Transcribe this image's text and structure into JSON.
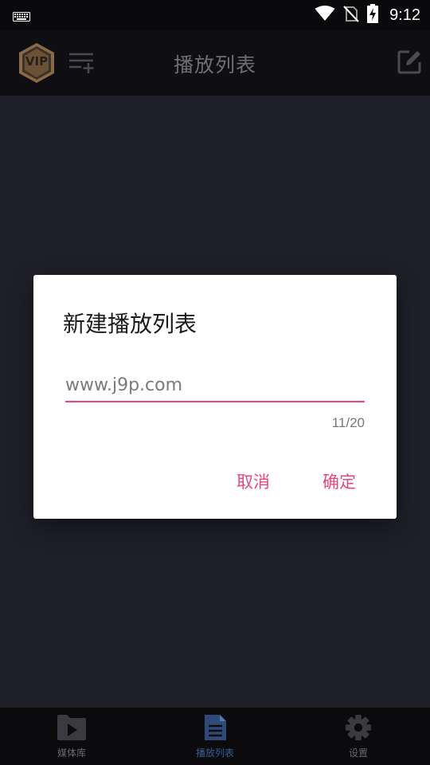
{
  "status_bar": {
    "time": "9:12",
    "icons": [
      "keyboard-icon",
      "wifi-icon",
      "no-sim-icon",
      "battery-charging-icon"
    ]
  },
  "app_bar": {
    "vip_label": "VIP",
    "title": "播放列表",
    "left_icons": [
      "vip-badge-icon",
      "add-playlist-icon"
    ],
    "right_icon": "edit-icon"
  },
  "dialog": {
    "title": "新建播放列表",
    "input_value": "www.j9p.com",
    "counter": "11/20",
    "cancel_label": "取消",
    "ok_label": "确定"
  },
  "bottom_nav": {
    "items": [
      {
        "label": "媒体库",
        "icon": "media-library-icon",
        "active": false
      },
      {
        "label": "播放列表",
        "icon": "playlist-icon",
        "active": true
      },
      {
        "label": "设置",
        "icon": "settings-icon",
        "active": false
      }
    ]
  },
  "colors": {
    "accent": "#e8477e",
    "nav_active": "#3b5d93",
    "background": "#1f1f28",
    "app_bar": "#0f0f13"
  }
}
